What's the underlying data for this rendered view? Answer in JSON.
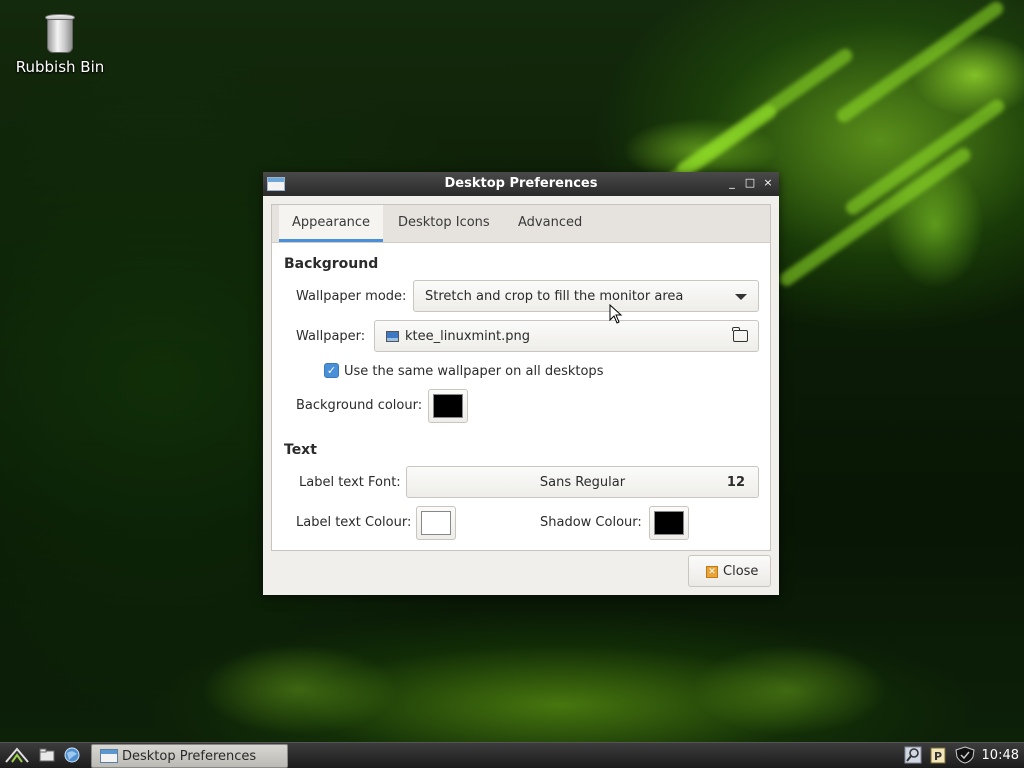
{
  "desktop": {
    "icons": [
      {
        "label": "Rubbish Bin",
        "icon": "trash-bin-icon"
      }
    ]
  },
  "dialog": {
    "title": "Desktop Preferences",
    "window_buttons": {
      "minimize": "_",
      "maximize": "□",
      "close": "×"
    },
    "tabs": [
      {
        "label": "Appearance",
        "active": true
      },
      {
        "label": "Desktop Icons",
        "active": false
      },
      {
        "label": "Advanced",
        "active": false
      }
    ],
    "background": {
      "section_title": "Background",
      "wallpaper_mode_label": "Wallpaper mode:",
      "wallpaper_mode_value": "Stretch and crop to fill the monitor area",
      "wallpaper_label": "Wallpaper:",
      "wallpaper_value": "ktee_linuxmint.png",
      "same_wallpaper_label": "Use the same wallpaper on all desktops",
      "same_wallpaper_checked": true,
      "background_colour_label": "Background colour:",
      "background_colour": "#000000"
    },
    "text": {
      "section_title": "Text",
      "label_font_label": "Label text Font:",
      "label_font_name": "Sans Regular",
      "label_font_size": "12",
      "label_colour_label": "Label text Colour:",
      "label_colour": "#ffffff",
      "shadow_colour_label": "Shadow Colour:",
      "shadow_colour": "#000000"
    },
    "close_label": "Close"
  },
  "taskbar": {
    "launchers": [
      "menu-icon",
      "file-manager-icon",
      "web-browser-icon"
    ],
    "task_label": "Desktop Preferences",
    "tray_icons": [
      "search-icon",
      "clipboard-icon",
      "shield-icon"
    ],
    "clock": "10:48"
  },
  "colors": {
    "accent": "#4a90d9",
    "titlebar": "#333333"
  }
}
